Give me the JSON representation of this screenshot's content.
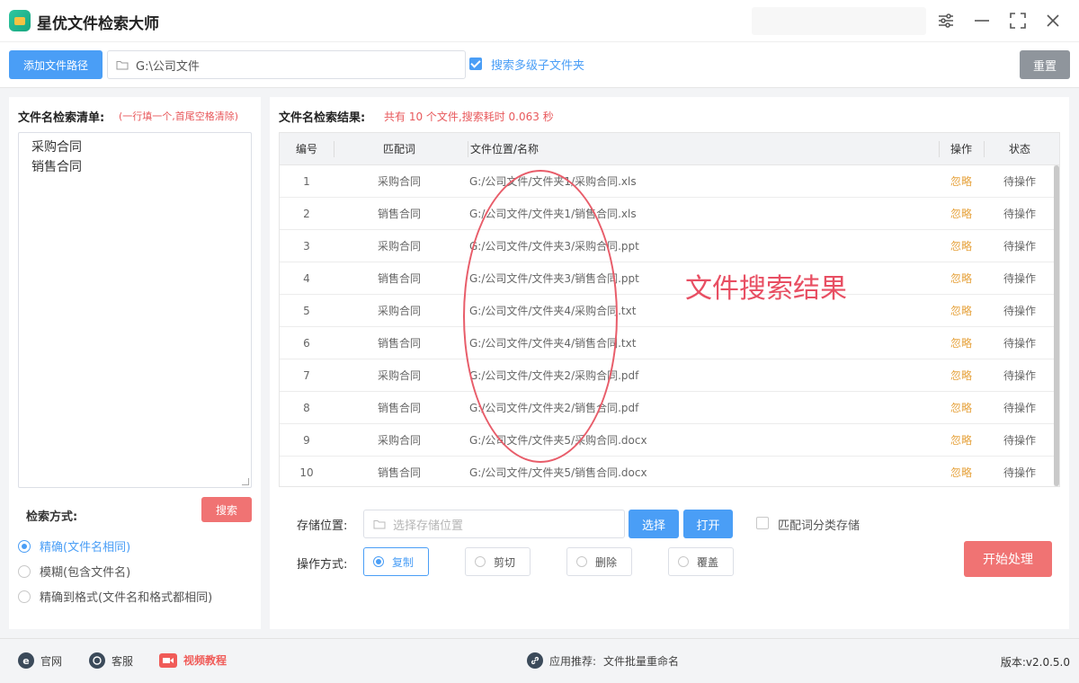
{
  "app": {
    "title": "星优文件检索大师"
  },
  "toolbar": {
    "add_path_label": "添加文件路径",
    "path_value": "G:\\公司文件",
    "multi_level_label": "搜索多级子文件夹",
    "multi_level_checked": true,
    "reset_label": "重置"
  },
  "left": {
    "list_title": "文件名检索清单:",
    "list_hint": "(一行填一个,首尾空格清除)",
    "names": [
      "采购合同",
      "销售合同"
    ],
    "search_mode_label": "检索方式:",
    "search_button": "搜索",
    "modes": [
      {
        "label": "精确(文件名相同)",
        "selected": true
      },
      {
        "label": "模糊(包含文件名)",
        "selected": false
      },
      {
        "label": "精确到格式(文件名和格式都相同)",
        "selected": false
      }
    ]
  },
  "results": {
    "title": "文件名检索结果:",
    "summary": "共有 10 个文件,搜索耗时 0.063 秒",
    "columns": {
      "index": "编号",
      "keyword": "匹配词",
      "path": "文件位置/名称",
      "op": "操作",
      "status": "状态"
    },
    "rows": [
      {
        "index": "1",
        "keyword": "采购合同",
        "path": "G:/公司文件/文件夹1/采购合同.xls",
        "op": "忽略",
        "status": "待操作"
      },
      {
        "index": "2",
        "keyword": "销售合同",
        "path": "G:/公司文件/文件夹1/销售合同.xls",
        "op": "忽略",
        "status": "待操作"
      },
      {
        "index": "3",
        "keyword": "采购合同",
        "path": "G:/公司文件/文件夹3/采购合同.ppt",
        "op": "忽略",
        "status": "待操作"
      },
      {
        "index": "4",
        "keyword": "销售合同",
        "path": "G:/公司文件/文件夹3/销售合同.ppt",
        "op": "忽略",
        "status": "待操作"
      },
      {
        "index": "5",
        "keyword": "采购合同",
        "path": "G:/公司文件/文件夹4/采购合同.txt",
        "op": "忽略",
        "status": "待操作"
      },
      {
        "index": "6",
        "keyword": "销售合同",
        "path": "G:/公司文件/文件夹4/销售合同.txt",
        "op": "忽略",
        "status": "待操作"
      },
      {
        "index": "7",
        "keyword": "采购合同",
        "path": "G:/公司文件/文件夹2/采购合同.pdf",
        "op": "忽略",
        "status": "待操作"
      },
      {
        "index": "8",
        "keyword": "销售合同",
        "path": "G:/公司文件/文件夹2/销售合同.pdf",
        "op": "忽略",
        "status": "待操作"
      },
      {
        "index": "9",
        "keyword": "采购合同",
        "path": "G:/公司文件/文件夹5/采购合同.docx",
        "op": "忽略",
        "status": "待操作"
      },
      {
        "index": "10",
        "keyword": "销售合同",
        "path": "G:/公司文件/文件夹5/销售合同.docx",
        "op": "忽略",
        "status": "待操作"
      }
    ],
    "annotation": "文件搜索结果"
  },
  "storage": {
    "label": "存储位置:",
    "placeholder": "选择存储位置",
    "choose_label": "选择",
    "open_label": "打开",
    "classify_label": "匹配词分类存储",
    "classify_checked": false
  },
  "operation": {
    "label": "操作方式:",
    "options": [
      {
        "label": "复制",
        "selected": true
      },
      {
        "label": "剪切",
        "selected": false
      },
      {
        "label": "删除",
        "selected": false
      },
      {
        "label": "覆盖",
        "selected": false
      }
    ],
    "start_label": "开始处理"
  },
  "footer": {
    "official_label": "官网",
    "service_label": "客服",
    "video_label": "视频教程",
    "recommend_prefix": "应用推荐:",
    "recommend_app": "文件批量重命名",
    "version": "版本:v2.0.5.0"
  },
  "colors": {
    "accent": "#4a9ef6",
    "danger": "#f07373",
    "warning": "#e6a23c",
    "neutral_button": "#8f959c"
  }
}
